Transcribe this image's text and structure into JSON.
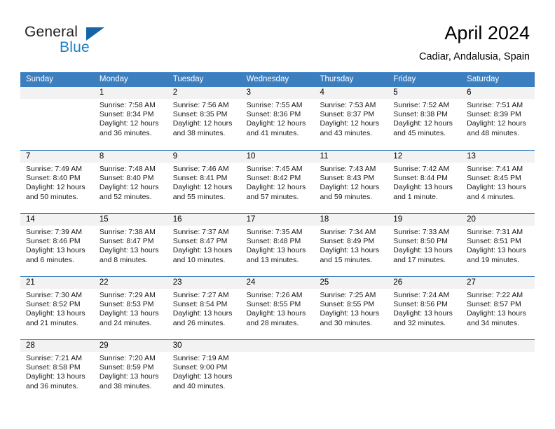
{
  "brand": {
    "word1": "General",
    "word2": "Blue",
    "triangle_color": "#1565a8",
    "blue_color": "#1b7fc4"
  },
  "header": {
    "title": "April 2024",
    "location": "Cadiar, Andalusia, Spain"
  },
  "theme": {
    "header_band": "#3c7fc0",
    "day_number_band": "#f2f2f2",
    "text": "#000000"
  },
  "weekdays": [
    "Sunday",
    "Monday",
    "Tuesday",
    "Wednesday",
    "Thursday",
    "Friday",
    "Saturday"
  ],
  "weeks": [
    [
      {
        "day": "",
        "lines": []
      },
      {
        "day": "1",
        "lines": [
          "Sunrise: 7:58 AM",
          "Sunset: 8:34 PM",
          "Daylight: 12 hours",
          "and 36 minutes."
        ]
      },
      {
        "day": "2",
        "lines": [
          "Sunrise: 7:56 AM",
          "Sunset: 8:35 PM",
          "Daylight: 12 hours",
          "and 38 minutes."
        ]
      },
      {
        "day": "3",
        "lines": [
          "Sunrise: 7:55 AM",
          "Sunset: 8:36 PM",
          "Daylight: 12 hours",
          "and 41 minutes."
        ]
      },
      {
        "day": "4",
        "lines": [
          "Sunrise: 7:53 AM",
          "Sunset: 8:37 PM",
          "Daylight: 12 hours",
          "and 43 minutes."
        ]
      },
      {
        "day": "5",
        "lines": [
          "Sunrise: 7:52 AM",
          "Sunset: 8:38 PM",
          "Daylight: 12 hours",
          "and 45 minutes."
        ]
      },
      {
        "day": "6",
        "lines": [
          "Sunrise: 7:51 AM",
          "Sunset: 8:39 PM",
          "Daylight: 12 hours",
          "and 48 minutes."
        ]
      }
    ],
    [
      {
        "day": "7",
        "lines": [
          "Sunrise: 7:49 AM",
          "Sunset: 8:40 PM",
          "Daylight: 12 hours",
          "and 50 minutes."
        ]
      },
      {
        "day": "8",
        "lines": [
          "Sunrise: 7:48 AM",
          "Sunset: 8:40 PM",
          "Daylight: 12 hours",
          "and 52 minutes."
        ]
      },
      {
        "day": "9",
        "lines": [
          "Sunrise: 7:46 AM",
          "Sunset: 8:41 PM",
          "Daylight: 12 hours",
          "and 55 minutes."
        ]
      },
      {
        "day": "10",
        "lines": [
          "Sunrise: 7:45 AM",
          "Sunset: 8:42 PM",
          "Daylight: 12 hours",
          "and 57 minutes."
        ]
      },
      {
        "day": "11",
        "lines": [
          "Sunrise: 7:43 AM",
          "Sunset: 8:43 PM",
          "Daylight: 12 hours",
          "and 59 minutes."
        ]
      },
      {
        "day": "12",
        "lines": [
          "Sunrise: 7:42 AM",
          "Sunset: 8:44 PM",
          "Daylight: 13 hours",
          "and 1 minute."
        ]
      },
      {
        "day": "13",
        "lines": [
          "Sunrise: 7:41 AM",
          "Sunset: 8:45 PM",
          "Daylight: 13 hours",
          "and 4 minutes."
        ]
      }
    ],
    [
      {
        "day": "14",
        "lines": [
          "Sunrise: 7:39 AM",
          "Sunset: 8:46 PM",
          "Daylight: 13 hours",
          "and 6 minutes."
        ]
      },
      {
        "day": "15",
        "lines": [
          "Sunrise: 7:38 AM",
          "Sunset: 8:47 PM",
          "Daylight: 13 hours",
          "and 8 minutes."
        ]
      },
      {
        "day": "16",
        "lines": [
          "Sunrise: 7:37 AM",
          "Sunset: 8:47 PM",
          "Daylight: 13 hours",
          "and 10 minutes."
        ]
      },
      {
        "day": "17",
        "lines": [
          "Sunrise: 7:35 AM",
          "Sunset: 8:48 PM",
          "Daylight: 13 hours",
          "and 13 minutes."
        ]
      },
      {
        "day": "18",
        "lines": [
          "Sunrise: 7:34 AM",
          "Sunset: 8:49 PM",
          "Daylight: 13 hours",
          "and 15 minutes."
        ]
      },
      {
        "day": "19",
        "lines": [
          "Sunrise: 7:33 AM",
          "Sunset: 8:50 PM",
          "Daylight: 13 hours",
          "and 17 minutes."
        ]
      },
      {
        "day": "20",
        "lines": [
          "Sunrise: 7:31 AM",
          "Sunset: 8:51 PM",
          "Daylight: 13 hours",
          "and 19 minutes."
        ]
      }
    ],
    [
      {
        "day": "21",
        "lines": [
          "Sunrise: 7:30 AM",
          "Sunset: 8:52 PM",
          "Daylight: 13 hours",
          "and 21 minutes."
        ]
      },
      {
        "day": "22",
        "lines": [
          "Sunrise: 7:29 AM",
          "Sunset: 8:53 PM",
          "Daylight: 13 hours",
          "and 24 minutes."
        ]
      },
      {
        "day": "23",
        "lines": [
          "Sunrise: 7:27 AM",
          "Sunset: 8:54 PM",
          "Daylight: 13 hours",
          "and 26 minutes."
        ]
      },
      {
        "day": "24",
        "lines": [
          "Sunrise: 7:26 AM",
          "Sunset: 8:55 PM",
          "Daylight: 13 hours",
          "and 28 minutes."
        ]
      },
      {
        "day": "25",
        "lines": [
          "Sunrise: 7:25 AM",
          "Sunset: 8:55 PM",
          "Daylight: 13 hours",
          "and 30 minutes."
        ]
      },
      {
        "day": "26",
        "lines": [
          "Sunrise: 7:24 AM",
          "Sunset: 8:56 PM",
          "Daylight: 13 hours",
          "and 32 minutes."
        ]
      },
      {
        "day": "27",
        "lines": [
          "Sunrise: 7:22 AM",
          "Sunset: 8:57 PM",
          "Daylight: 13 hours",
          "and 34 minutes."
        ]
      }
    ],
    [
      {
        "day": "28",
        "lines": [
          "Sunrise: 7:21 AM",
          "Sunset: 8:58 PM",
          "Daylight: 13 hours",
          "and 36 minutes."
        ]
      },
      {
        "day": "29",
        "lines": [
          "Sunrise: 7:20 AM",
          "Sunset: 8:59 PM",
          "Daylight: 13 hours",
          "and 38 minutes."
        ]
      },
      {
        "day": "30",
        "lines": [
          "Sunrise: 7:19 AM",
          "Sunset: 9:00 PM",
          "Daylight: 13 hours",
          "and 40 minutes."
        ]
      },
      {
        "day": "",
        "lines": []
      },
      {
        "day": "",
        "lines": []
      },
      {
        "day": "",
        "lines": []
      },
      {
        "day": "",
        "lines": []
      }
    ]
  ]
}
